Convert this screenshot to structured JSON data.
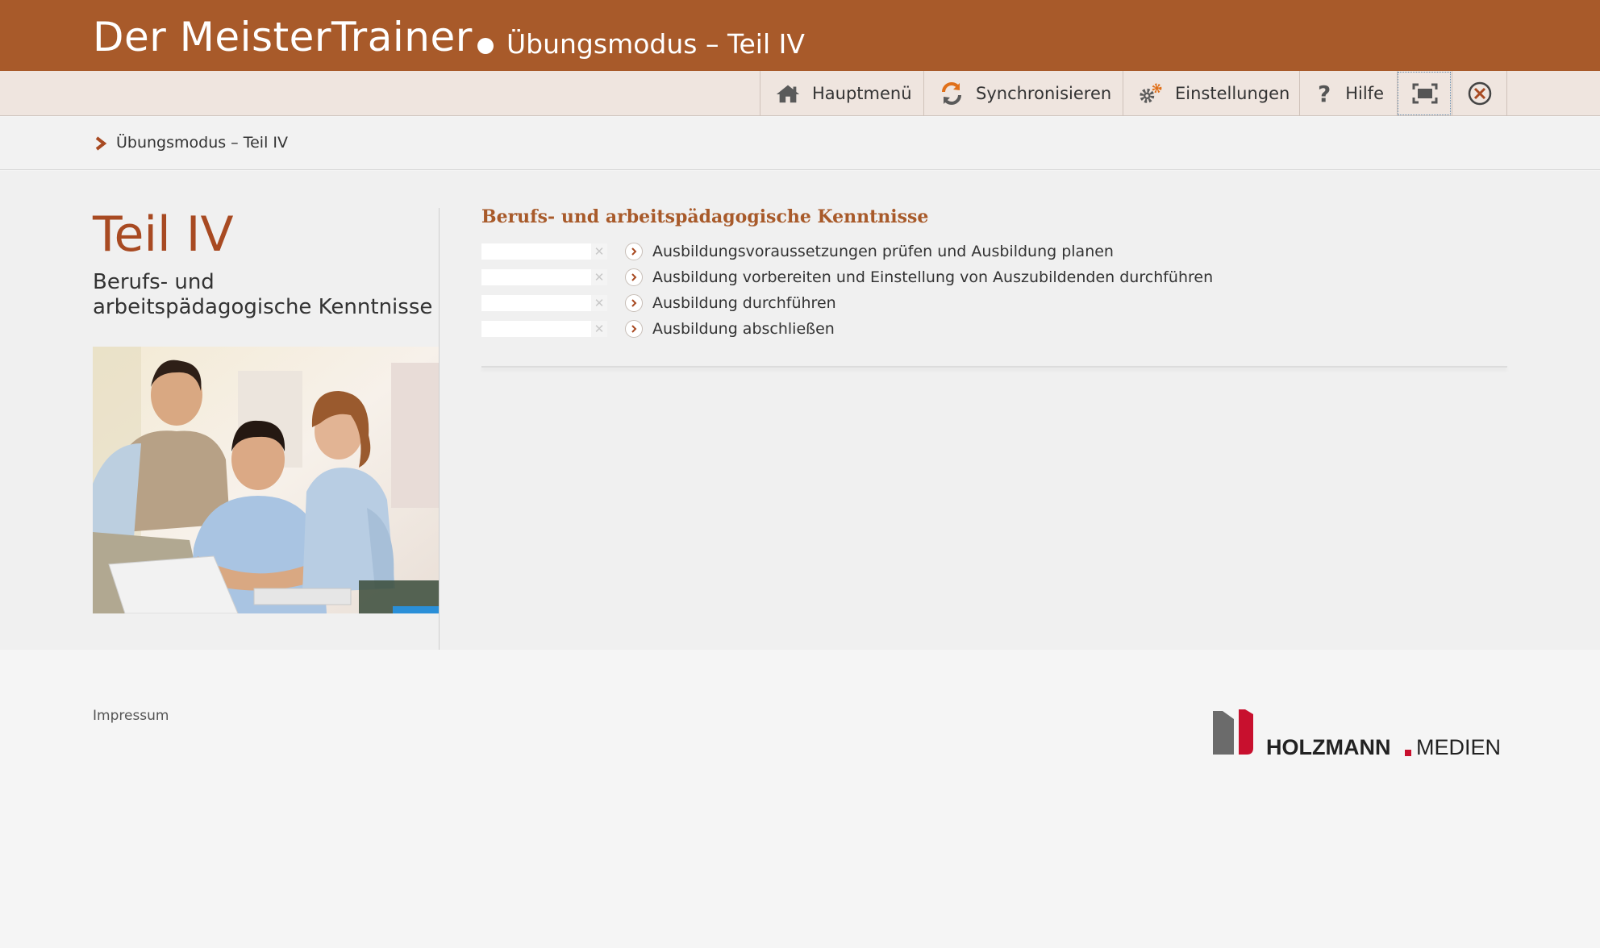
{
  "header": {
    "app_title": "Der MeisterTrainer",
    "mode_title": "Übungsmodus – Teil IV"
  },
  "toolbar": {
    "items": [
      {
        "label": "Hauptmenü",
        "icon": "home-icon"
      },
      {
        "label": "Synchronisieren",
        "icon": "sync-icon"
      },
      {
        "label": "Einstellungen",
        "icon": "gear-icon"
      },
      {
        "label": "Hilfe",
        "icon": "help-icon"
      },
      {
        "label": "",
        "icon": "fullscreen-icon"
      },
      {
        "label": "",
        "icon": "close-icon"
      }
    ]
  },
  "breadcrumb": {
    "current": "Übungsmodus – Teil IV"
  },
  "main": {
    "part_title": "Teil IV",
    "part_subtitle": "Berufs- und arbeitspädagogische Kenntnisse",
    "section_title": "Berufs- und arbeitspädagogische Kenntnisse",
    "topics": [
      {
        "label": "Ausbildungsvoraussetzungen prüfen und Ausbildung planen",
        "progress": 0
      },
      {
        "label": "Ausbildung vorbereiten und Einstellung von Auszubildenden durchführen",
        "progress": 0
      },
      {
        "label": "Ausbildung durchführen",
        "progress": 0
      },
      {
        "label": "Ausbildung abschließen",
        "progress": 0
      }
    ]
  },
  "footer": {
    "impressum": "Impressum",
    "logo_brand": "HOLZMANN",
    "logo_sub": "MEDIEN"
  },
  "colors": {
    "header_bg": "#a85a2a",
    "toolbar_bg": "#efe5df",
    "accent": "#a84a22",
    "logo_red": "#c8102e"
  }
}
